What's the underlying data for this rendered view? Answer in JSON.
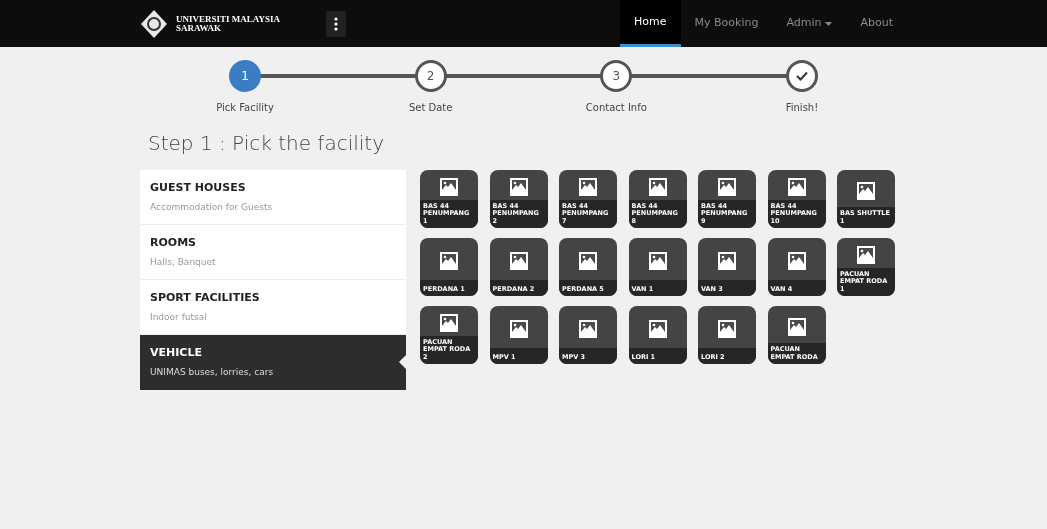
{
  "navbar": {
    "brand": "UNIVERSITI MALAYSIA SARAWAK",
    "links": [
      {
        "label": "Home",
        "selected": true,
        "dropdown": false
      },
      {
        "label": "My Booking",
        "selected": false,
        "dropdown": false
      },
      {
        "label": "Admin",
        "selected": false,
        "dropdown": true
      },
      {
        "label": "About",
        "selected": false,
        "dropdown": false
      }
    ]
  },
  "steps": [
    {
      "number": "1",
      "label": "Pick Facility",
      "kind": "active"
    },
    {
      "number": "2",
      "label": "Set Date",
      "kind": "pending"
    },
    {
      "number": "3",
      "label": "Contact Info",
      "kind": "pending"
    },
    {
      "label": "Finish!",
      "kind": "final"
    }
  ],
  "heading": "Step 1 : Pick the facility",
  "categories": [
    {
      "title": "GUEST HOUSES",
      "subtitle": "Accommodation for Guests",
      "selected": false
    },
    {
      "title": "ROOMS",
      "subtitle": "Halls, Banquet",
      "selected": false
    },
    {
      "title": "SPORT FACILITIES",
      "subtitle": "Indoor futsal",
      "selected": false
    },
    {
      "title": "VEHICLE",
      "subtitle": "UNIMAS buses, lorries, cars",
      "selected": true
    }
  ],
  "facilities": [
    "BAS 44 PENUMPANG 1",
    "BAS 44 PENUMPANG 2",
    "BAS 44 PENUMPANG 7",
    "BAS 44 PENUMPANG 8",
    "BAS 44 PENUMPANG 9",
    "BAS 44 PENUMPANG 10",
    "BAS SHUTTLE 1",
    "PERDANA 1",
    "PERDANA 2",
    "PERDANA 5",
    "VAN 1",
    "VAN 3",
    "VAN 4",
    "PACUAN EMPAT RODA 1",
    "PACUAN EMPAT RODA 2",
    "MPV 1",
    "MPV 3",
    "LORI 1",
    "LORI 2",
    "PACUAN EMPAT RODA"
  ]
}
